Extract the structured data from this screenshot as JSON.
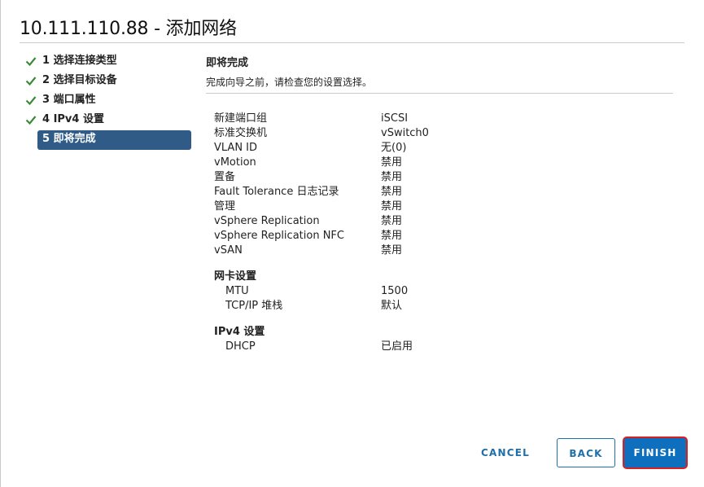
{
  "dialog": {
    "title": "10.111.110.88 - 添加网络"
  },
  "steps": [
    {
      "label": "1 选择连接类型",
      "done": true
    },
    {
      "label": "2 选择目标设备",
      "done": true
    },
    {
      "label": "3 端口属性",
      "done": true
    },
    {
      "label": "4 IPv4 设置",
      "done": true
    },
    {
      "label": "5 即将完成",
      "done": false,
      "active": true
    }
  ],
  "content": {
    "heading": "即将完成",
    "subtitle": "完成向导之前，请检查您的设置选择。"
  },
  "summary": [
    {
      "key": "新建端口组",
      "value": "iSCSI"
    },
    {
      "key": "标准交换机",
      "value": "vSwitch0"
    },
    {
      "key": "VLAN ID",
      "value": "无(0)"
    },
    {
      "key": "vMotion",
      "value": "禁用"
    },
    {
      "key": "置备",
      "value": "禁用"
    },
    {
      "key": "Fault Tolerance 日志记录",
      "value": "禁用"
    },
    {
      "key": "管理",
      "value": "禁用"
    },
    {
      "key": "vSphere Replication",
      "value": "禁用"
    },
    {
      "key": "vSphere Replication NFC",
      "value": "禁用"
    },
    {
      "key": "vSAN",
      "value": "禁用"
    }
  ],
  "nic": {
    "heading": "网卡设置",
    "rows": [
      {
        "key": "MTU",
        "value": "1500"
      },
      {
        "key": "TCP/IP 堆栈",
        "value": "默认"
      }
    ]
  },
  "ipv4": {
    "heading": "IPv4 设置",
    "rows": [
      {
        "key": "DHCP",
        "value": "已启用"
      }
    ]
  },
  "footer": {
    "cancel": "CANCEL",
    "back": "BACK",
    "finish": "FINISH"
  },
  "colors": {
    "accent": "#0e6fbf",
    "active_step": "#2f5b86",
    "check": "#3c8a3c",
    "highlight": "#d92020"
  },
  "icons": {
    "step_done": "check-icon"
  }
}
